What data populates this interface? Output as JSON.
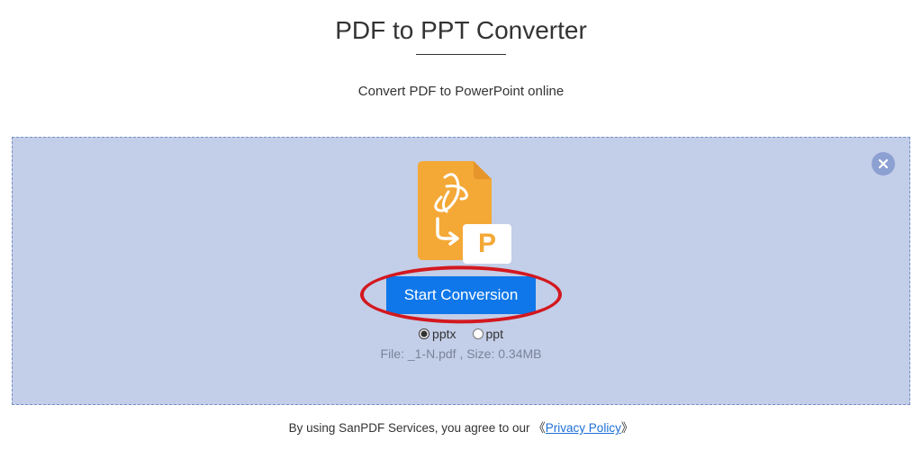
{
  "title": "PDF to PPT Converter",
  "subtitle": "Convert PDF to PowerPoint online",
  "icon": {
    "ppt_letter": "P"
  },
  "button": {
    "start_conversion": "Start Conversion"
  },
  "formats": {
    "pptx": "pptx",
    "ppt": "ppt",
    "selected": "pptx"
  },
  "file_info": "File: _1-N.pdf , Size: 0.34MB",
  "footer": {
    "prefix": "By using SanPDF Services, you agree to our ",
    "bracket_open": "《",
    "link_text": "Privacy Policy",
    "bracket_close": "》"
  }
}
